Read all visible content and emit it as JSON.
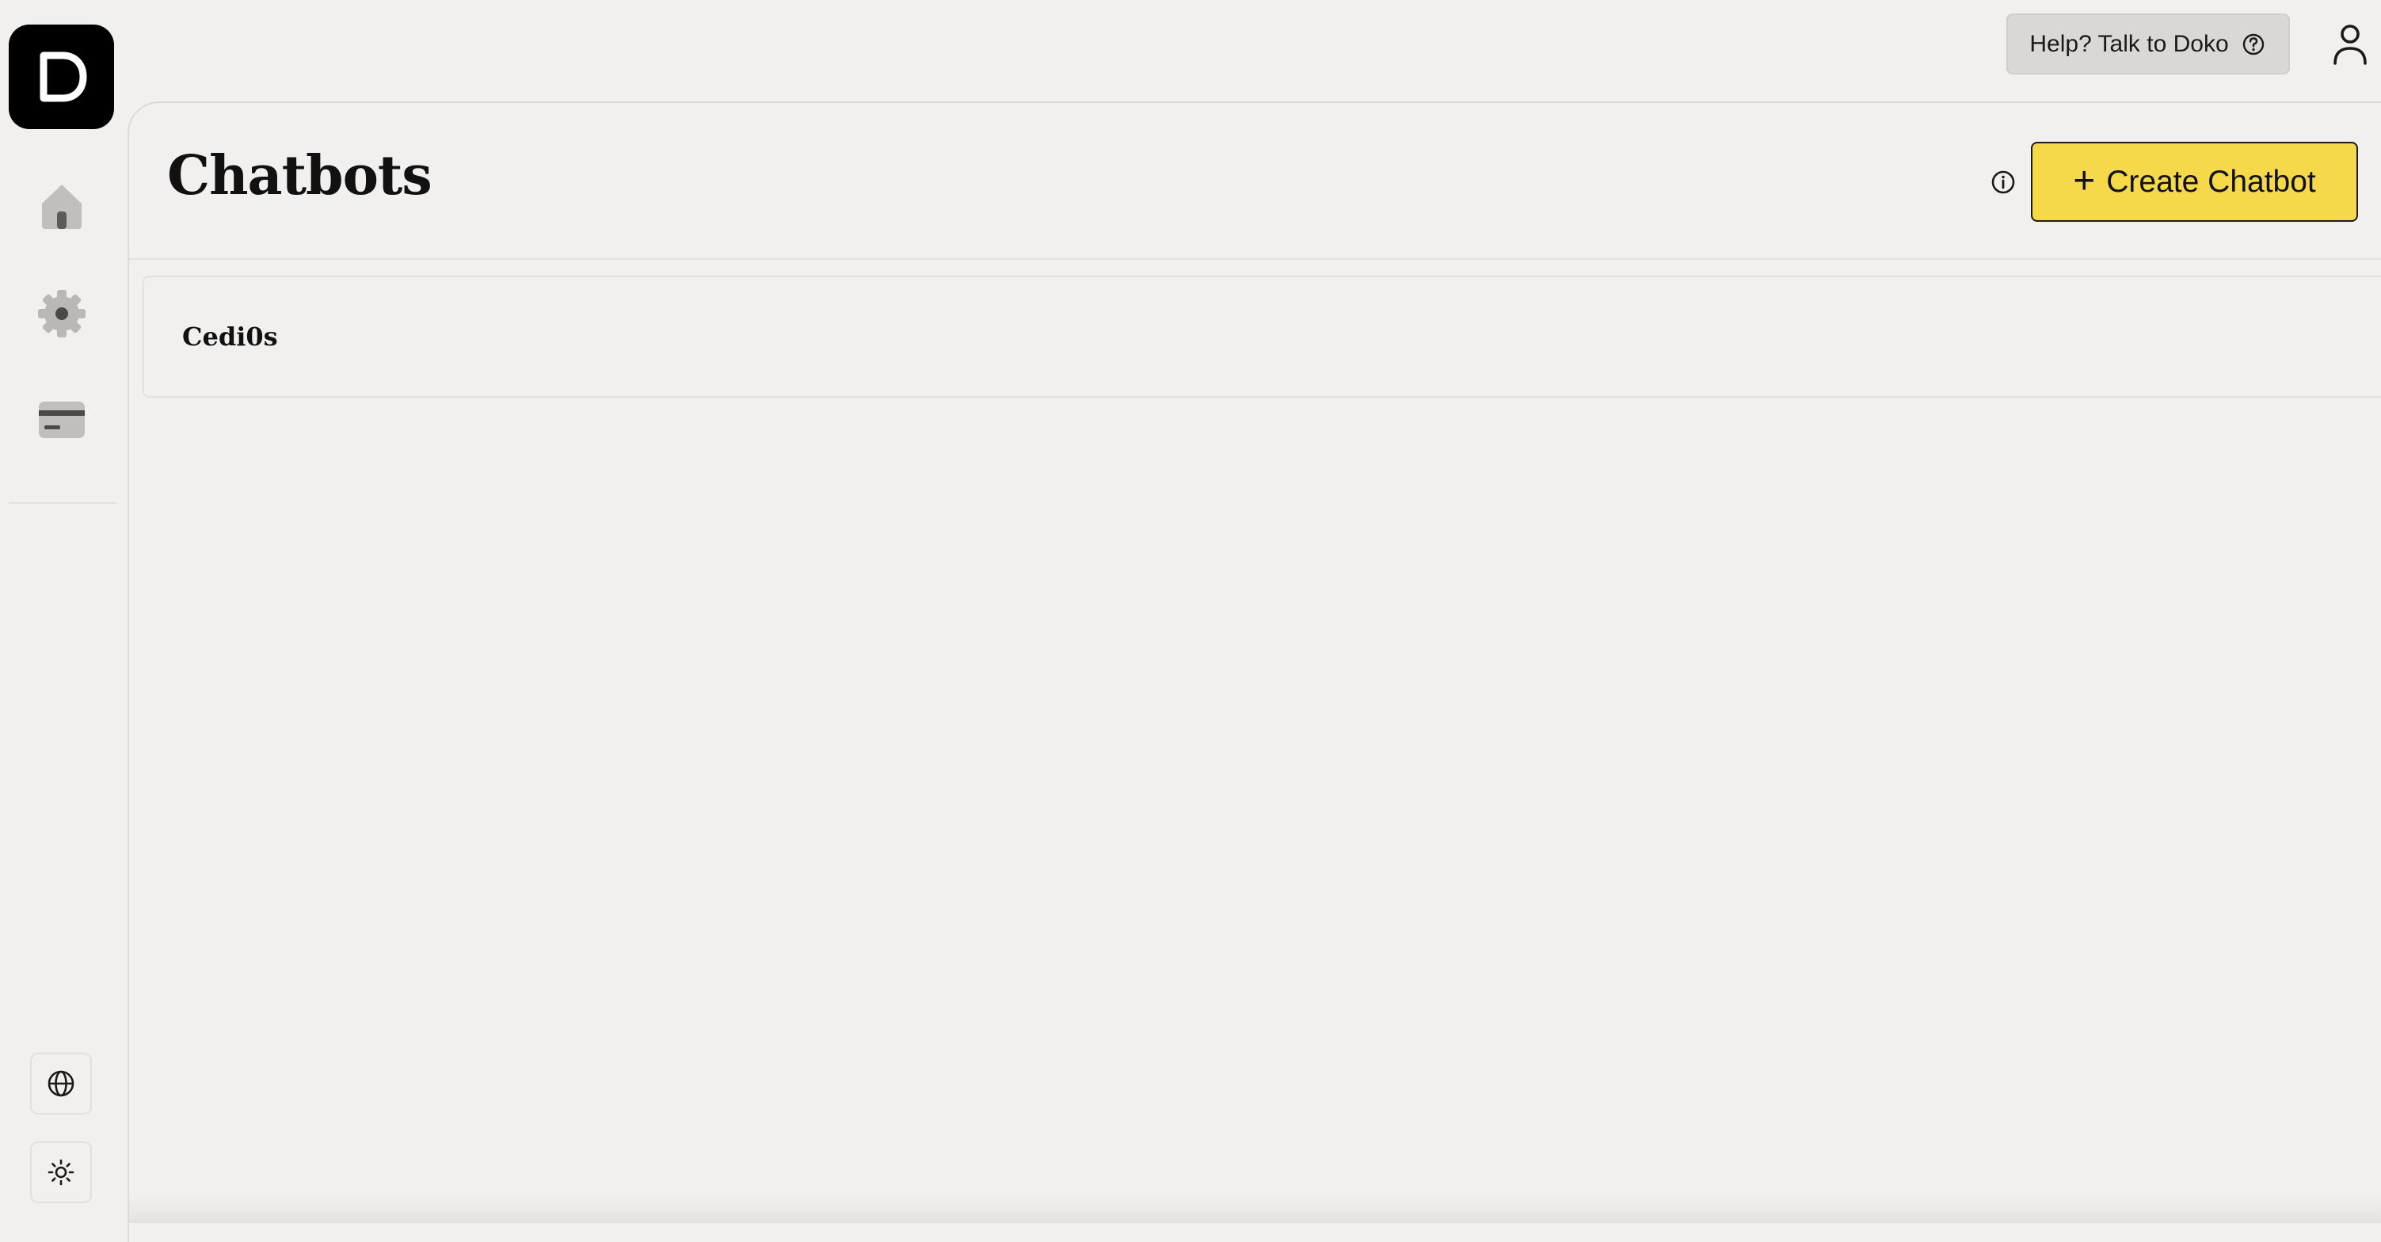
{
  "brand": {
    "logo_letter": "D",
    "colors": {
      "background": "#f1f0ee",
      "accent": "#f5d94a",
      "logo_bg": "#000000"
    }
  },
  "sidebar": {
    "items": [
      {
        "icon": "home-icon",
        "label": ""
      },
      {
        "icon": "gear-icon",
        "label": ""
      },
      {
        "icon": "credit-card-icon",
        "label": ""
      }
    ],
    "bottom": [
      {
        "icon": "globe-icon"
      },
      {
        "icon": "sun-icon"
      }
    ]
  },
  "topbar": {
    "help_label": "Help? Talk to Doko",
    "help_icon": "question-circle-icon",
    "user_icon": "user-icon"
  },
  "main": {
    "title": "Chatbots",
    "info_icon": "info-icon",
    "create_button_label": "Create Chatbot",
    "create_button_icon": "plus-icon",
    "chatbots": [
      {
        "name": "Cedi0s"
      }
    ]
  }
}
